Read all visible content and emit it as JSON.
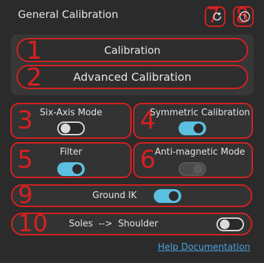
{
  "header": {
    "title": "General Calibration",
    "reset_number": "7",
    "help_number": "8"
  },
  "calibration_group": {
    "calibration_button": {
      "number": "1",
      "label": "Calibration"
    },
    "advanced_button": {
      "number": "2",
      "label": "Advanced Calibration"
    }
  },
  "options": [
    {
      "number": "3",
      "label": "Six-Axis Mode",
      "state": "off"
    },
    {
      "number": "4",
      "label": "Symmetric Calibration",
      "state": "on"
    },
    {
      "number": "5",
      "label": "Filter",
      "state": "on"
    },
    {
      "number": "6",
      "label": "Anti-magnetic Mode",
      "state": "disabled"
    }
  ],
  "rows": [
    {
      "number": "9",
      "label": "Ground IK",
      "state": "on"
    },
    {
      "number": "10",
      "label": "Soles  -->  Shoulder",
      "state": "off"
    }
  ],
  "footer": {
    "help_link": "Help Documentation"
  },
  "colors": {
    "accent": "#5bbfe0",
    "annotation_red": "#d92020",
    "link": "#4aa3df"
  },
  "icons": {
    "reset": "refresh-icon",
    "help": "question-circle-icon"
  }
}
